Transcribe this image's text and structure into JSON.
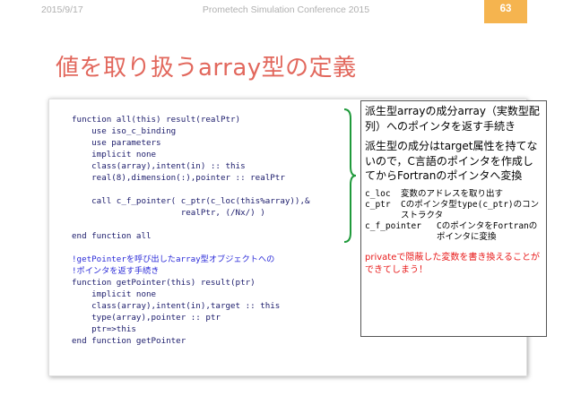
{
  "header": {
    "date": "2015/9/17",
    "conference": "Prometech Simulation Conference 2015",
    "slide_number": "63"
  },
  "title": "値を取り扱うarray型の定義",
  "code_lines": [
    "function all(this) result(realPtr)",
    "    use iso_c_binding",
    "    use parameters",
    "    implicit none",
    "    class(array),intent(in) :: this",
    "    real(8),dimension(:),pointer :: realPtr",
    "",
    "    call c_f_pointer( c_ptr(c_loc(this%array)),&",
    "                      realPtr, (/Nx/) )",
    "",
    "end function all",
    "",
    "!getPointerを呼び出したarray型オブジェクトへの",
    "!ポインタを返す手続き",
    "function getPointer(this) result(ptr)",
    "    implicit none",
    "    class(array),intent(in),target :: this",
    "    type(array),pointer :: ptr",
    "    ptr=>this",
    "end function getPointer"
  ],
  "note": {
    "para1": "派生型arrayの成分array（実数型配列）へのポインタを返す手続き",
    "para2": "派生型の成分はtarget属性を持てないので，C言語のポインタを作成してからFortranのポインタへ変換",
    "defs": [
      {
        "term": "c_loc",
        "desc": "変数のアドレスを取り出す"
      },
      {
        "term": "c_ptr",
        "desc": "Cのポインタ型type(c_ptr)のコンストラクタ"
      },
      {
        "term": "c_f_pointer",
        "desc": "CのポインタをFortranのポインタに変換"
      }
    ],
    "warning": "privateで隠蔽した変数を書き換えることができてしまう！"
  },
  "colors": {
    "title": "#e2685d",
    "accent_box": "#f5b44f",
    "code_text": "#1b1b6b",
    "code_keyword_blue": "#2b2bd8",
    "warning_red": "#e81a1a"
  }
}
